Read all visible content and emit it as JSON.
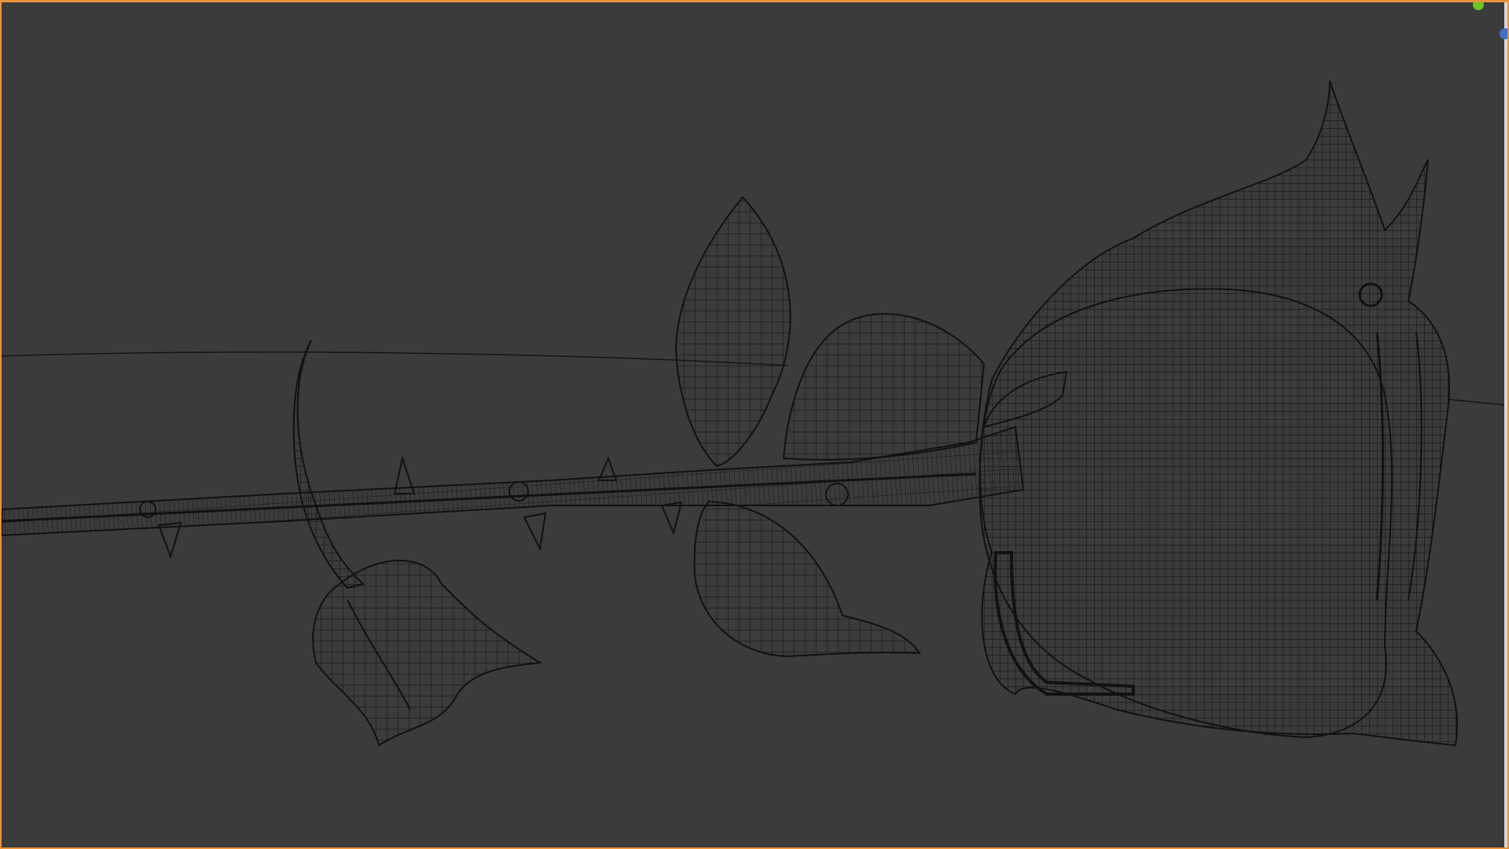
{
  "viewport": {
    "shading_mode": "wireframe",
    "subject": "rose",
    "active_border_color": "#e8923a",
    "background_color": "#3b3b3b",
    "wire_color": "#111111"
  },
  "gizmo": {
    "y_axis_color": "#6cc51f",
    "z_axis_color": "#3f6fc9"
  },
  "icons": {
    "gizmo_y": "axis-y-dot",
    "gizmo_z": "axis-z-dot"
  }
}
